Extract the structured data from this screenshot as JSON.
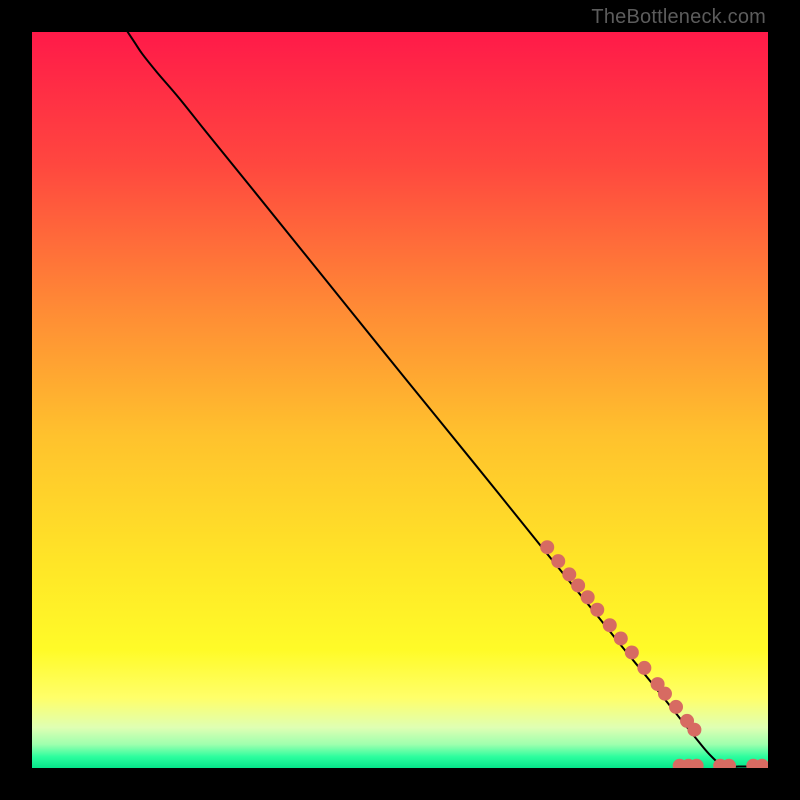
{
  "attribution": "TheBottleneck.com",
  "chart_data": {
    "type": "line",
    "title": "",
    "xlabel": "",
    "ylabel": "",
    "xlim": [
      0,
      100
    ],
    "ylim": [
      0,
      100
    ],
    "background_gradient_stops": [
      {
        "offset": 0.0,
        "color": "#ff1a49"
      },
      {
        "offset": 0.18,
        "color": "#ff473f"
      },
      {
        "offset": 0.38,
        "color": "#ff8c35"
      },
      {
        "offset": 0.55,
        "color": "#ffc22d"
      },
      {
        "offset": 0.72,
        "color": "#ffe527"
      },
      {
        "offset": 0.84,
        "color": "#fffb28"
      },
      {
        "offset": 0.905,
        "color": "#ffff6a"
      },
      {
        "offset": 0.945,
        "color": "#dfffb3"
      },
      {
        "offset": 0.968,
        "color": "#9effae"
      },
      {
        "offset": 0.985,
        "color": "#2bfd9e"
      },
      {
        "offset": 1.0,
        "color": "#06e58a"
      }
    ],
    "series": [
      {
        "name": "bottleneck-curve",
        "x": [
          13,
          14,
          15,
          17,
          20,
          24,
          30,
          40,
          50,
          60,
          70,
          76,
          80,
          84,
          86,
          88,
          90,
          92,
          94,
          96,
          98,
          100
        ],
        "y": [
          100,
          98.5,
          97,
          94.5,
          91,
          86,
          78.6,
          66.2,
          53.8,
          41.5,
          29.1,
          21.7,
          16.7,
          11.8,
          9.3,
          6.8,
          4.3,
          1.9,
          0.2,
          0.2,
          0.2,
          0.2
        ]
      }
    ],
    "markers": {
      "name": "sample-points",
      "color": "#d76b62",
      "radius_px": 7,
      "points": [
        {
          "x": 70.0,
          "y": 30.0
        },
        {
          "x": 71.5,
          "y": 28.1
        },
        {
          "x": 73.0,
          "y": 26.3
        },
        {
          "x": 74.2,
          "y": 24.8
        },
        {
          "x": 75.5,
          "y": 23.2
        },
        {
          "x": 76.8,
          "y": 21.5
        },
        {
          "x": 78.5,
          "y": 19.4
        },
        {
          "x": 80.0,
          "y": 17.6
        },
        {
          "x": 81.5,
          "y": 15.7
        },
        {
          "x": 83.2,
          "y": 13.6
        },
        {
          "x": 85.0,
          "y": 11.4
        },
        {
          "x": 86.0,
          "y": 10.1
        },
        {
          "x": 87.5,
          "y": 8.3
        },
        {
          "x": 89.0,
          "y": 6.4
        },
        {
          "x": 90.0,
          "y": 5.2
        },
        {
          "x": 88.0,
          "y": 0.3
        },
        {
          "x": 89.2,
          "y": 0.3
        },
        {
          "x": 90.3,
          "y": 0.3
        },
        {
          "x": 93.5,
          "y": 0.3
        },
        {
          "x": 94.7,
          "y": 0.3
        },
        {
          "x": 98.0,
          "y": 0.3
        },
        {
          "x": 99.2,
          "y": 0.3
        }
      ]
    }
  }
}
